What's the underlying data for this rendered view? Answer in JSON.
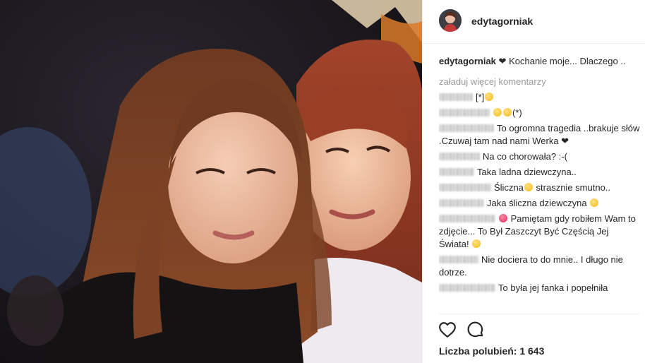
{
  "post": {
    "username": "edytagorniak",
    "caption_user": "edytagorniak",
    "caption_text": "Kochanie moje... Dlaczego ..",
    "load_more": "załaduj więcej komentarzy",
    "comments": [
      {
        "text": "[*]",
        "emoji": [
          "sad"
        ]
      },
      {
        "text": "(*)",
        "emoji": [
          "sad",
          "sad"
        ]
      },
      {
        "text": "To ogromna tragedia ..brakuje słów .Czuwaj tam nad nami Werka ❤"
      },
      {
        "text": "Na co chorowała? :-("
      },
      {
        "text": "Taka ladna dziewczyna.."
      },
      {
        "text": "Śliczna",
        "emoji": [
          "heart-eyes"
        ],
        "text_after": " strasznie smutno.."
      },
      {
        "text": "Jaka śliczna dziewczyna ",
        "emoji_after": [
          "crying"
        ]
      },
      {
        "text": "Pamiętam gdy robiłem Wam to zdjęcie... To Był Zaszczyt Być Częścią Jej Świata! ",
        "emoji_before": [
          "broken-heart"
        ],
        "emoji_after": [
          "crying"
        ]
      },
      {
        "text": "Nie dociera to do mnie.. I długo nie dotrze."
      },
      {
        "text": "To była jej fanka i popełniła"
      }
    ],
    "likes_label": "Liczba polubień: 1 643"
  },
  "icons": {
    "like": "heart-outline-icon",
    "comment": "comment-bubble-icon"
  },
  "colors": {
    "text": "#262626",
    "muted": "#999999",
    "border": "#efefef"
  }
}
